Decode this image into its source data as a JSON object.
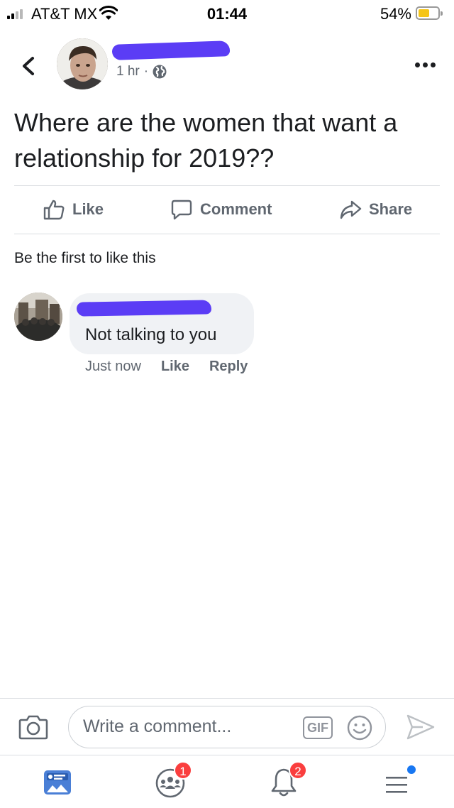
{
  "status_bar": {
    "carrier": "AT&T MX",
    "time": "01:44",
    "battery_percent": "54%",
    "battery_level": 0.54,
    "icons": [
      "signal-icon",
      "wifi-icon",
      "battery-icon"
    ]
  },
  "post": {
    "timestamp": "1 hr",
    "separator": "·",
    "privacy_icon": "globe-icon",
    "text": "Where are the women that want a relationship for 2019??",
    "actions": {
      "like": "Like",
      "comment": "Comment",
      "share": "Share"
    },
    "likes_summary": "Be the first to like this"
  },
  "comment": {
    "text": "Not talking to you",
    "time": "Just now",
    "like": "Like",
    "reply": "Reply"
  },
  "composer": {
    "placeholder": "Write a comment...",
    "gif_label": "GIF"
  },
  "tab_bar": {
    "groups_badge": "1",
    "notifications_badge": "2",
    "icons": [
      "news-feed-icon",
      "groups-icon",
      "notifications-bell-icon",
      "menu-icon"
    ]
  },
  "colors": {
    "redaction": "#5b3df5",
    "badge": "#fa3e3e",
    "battery": "#f5c518",
    "secondary_text": "#606770"
  }
}
